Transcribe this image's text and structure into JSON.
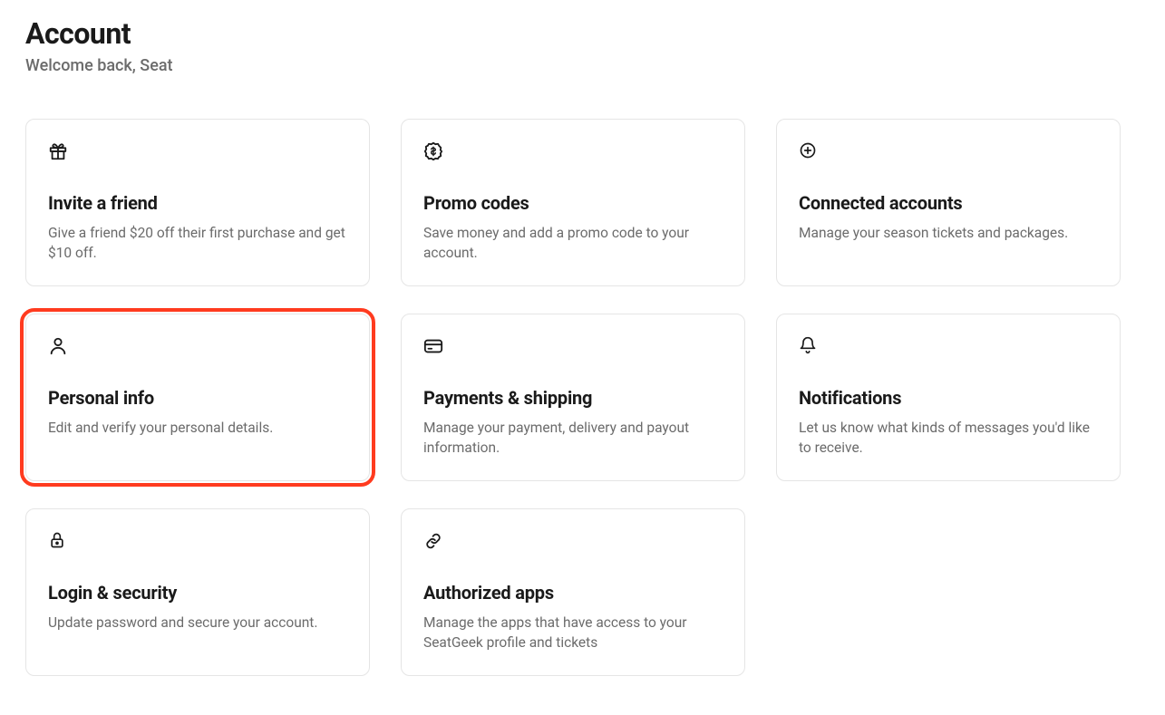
{
  "header": {
    "title": "Account",
    "subtitle": "Welcome back, Seat"
  },
  "cards": [
    {
      "title": "Invite a friend",
      "desc": "Give a friend $20 off their first purchase and get $10 off."
    },
    {
      "title": "Promo codes",
      "desc": "Save money and add a promo code to your account."
    },
    {
      "title": "Connected accounts",
      "desc": "Manage your season tickets and packages."
    },
    {
      "title": "Personal info",
      "desc": "Edit and verify your personal details."
    },
    {
      "title": "Payments & shipping",
      "desc": "Manage your payment, delivery and payout information."
    },
    {
      "title": "Notifications",
      "desc": "Let us know what kinds of messages you'd like to receive."
    },
    {
      "title": "Login & security",
      "desc": "Update password and secure your account."
    },
    {
      "title": "Authorized apps",
      "desc": "Manage the apps that have access to your SeatGeek profile and tickets"
    }
  ]
}
